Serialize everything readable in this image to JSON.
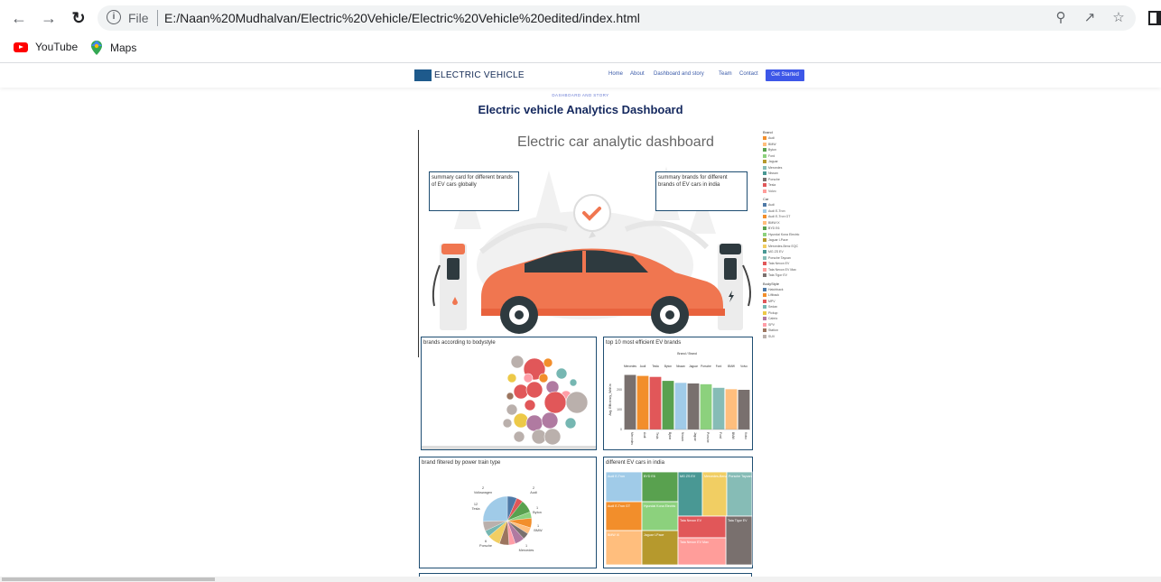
{
  "browser": {
    "scheme_label": "File",
    "url": "E:/Naan%20Mudhalvan/Electric%20Vehicle/Electric%20Vehicle%20edited/index.html",
    "bookmarks": [
      {
        "label": "YouTube",
        "icon": "youtube-icon"
      },
      {
        "label": "Maps",
        "icon": "maps-icon"
      }
    ]
  },
  "site": {
    "logo_text": "ELECTRIC VEHICLE",
    "nav": [
      "Home",
      "About",
      "Dashboard and story",
      "Team",
      "Contact"
    ],
    "cta": "Get Started",
    "eyebrow": "DASHBOARD AND STORY",
    "title": "Electric vehicle Analytics Dashboard"
  },
  "dashboard": {
    "hero_title": "Electric car analytic dashboard",
    "summary_global": "summary card for different brands of EV cars globally",
    "summary_india": "summary brands for different brands of EV cars in india",
    "bubble_title": "brands according to bodystyle",
    "bar_title": "top 10 most efficient EV brands",
    "pie_title": "brand filtered by power train type",
    "treemap_title": "different EV cars in india"
  },
  "legend": {
    "brand_head": "Brand",
    "brands": [
      {
        "label": "Audi",
        "color": "#f28e2b"
      },
      {
        "label": "BMW",
        "color": "#ffbe7d"
      },
      {
        "label": "Byton",
        "color": "#59a14f"
      },
      {
        "label": "Ford",
        "color": "#8cd17d"
      },
      {
        "label": "Jaguar",
        "color": "#b6992d"
      },
      {
        "label": "Mercedes",
        "color": "#86bcb6"
      },
      {
        "label": "Nissan",
        "color": "#499894"
      },
      {
        "label": "Porsche",
        "color": "#79706e"
      },
      {
        "label": "Tesla",
        "color": "#e15759"
      },
      {
        "label": "Volvo",
        "color": "#ff9d9a"
      }
    ],
    "car_head": "Car",
    "cars": [
      {
        "label": "Audi",
        "color": "#4e79a7"
      },
      {
        "label": "Audi E-Tron",
        "color": "#a0cbe8"
      },
      {
        "label": "Audi E-Tron GT",
        "color": "#f28e2b"
      },
      {
        "label": "BMW iX",
        "color": "#ffbe7d"
      },
      {
        "label": "BYD E6",
        "color": "#59a14f"
      },
      {
        "label": "Hyundai Kona Electric",
        "color": "#8cd17d"
      },
      {
        "label": "Jaguar I-Pace",
        "color": "#b6992d"
      },
      {
        "label": "Mercedes-Benz EQC",
        "color": "#f1ce63"
      },
      {
        "label": "MG ZS EV",
        "color": "#499894"
      },
      {
        "label": "Porsche Taycan",
        "color": "#86bcb6"
      },
      {
        "label": "Tata Nexon EV",
        "color": "#e15759"
      },
      {
        "label": "Tata Nexon EV Max",
        "color": "#ff9d9a"
      },
      {
        "label": "Tata Tigor EV",
        "color": "#79706e"
      }
    ],
    "body_head": "BodyStyle",
    "bodies": [
      {
        "label": "Hatchback",
        "color": "#4e79a7"
      },
      {
        "label": "Liftback",
        "color": "#f28e2b"
      },
      {
        "label": "MPV",
        "color": "#e15759"
      },
      {
        "label": "Sedan",
        "color": "#76b7b2"
      },
      {
        "label": "Pickup",
        "color": "#edc948"
      },
      {
        "label": "Cabrio",
        "color": "#b07aa1"
      },
      {
        "label": "SPV",
        "color": "#ff9da7"
      },
      {
        "label": "Station",
        "color": "#9c755f"
      },
      {
        "label": "SUV",
        "color": "#bab0ac"
      }
    ]
  },
  "chart_data": {
    "type": "bar",
    "title": "top 10 most efficient EV brands",
    "header": "Brand / Brand",
    "categories": [
      "Mercedes",
      "Audi",
      "Tesla",
      "Byton",
      "Nissan",
      "Jaguar",
      "Porsche",
      "Ford",
      "BMW",
      "Volvo"
    ],
    "colors": [
      "#79706e",
      "#f28e2b",
      "#e15759",
      "#59a14f",
      "#a0cbe8",
      "#79706e",
      "#8cd17d",
      "#86bcb6",
      "#ffbe7d",
      "#79706e"
    ],
    "values": [
      275,
      270,
      265,
      245,
      235,
      232,
      228,
      210,
      203,
      200
    ],
    "ylabel": "Avg. Efficiency_WhKm",
    "yticks": [
      0,
      100,
      200
    ],
    "ylim": [
      0,
      300
    ]
  },
  "pie": {
    "labels": [
      "Volkswagen",
      "Tesla",
      "Porsche",
      "Mercedes",
      "Audi",
      "Byton",
      "BMW"
    ],
    "values": [
      2,
      12,
      6,
      1,
      2,
      1,
      1
    ]
  },
  "treemap": [
    {
      "label": "Audi E-Tron",
      "color": "#a0cbe8"
    },
    {
      "label": "BYD E6",
      "color": "#59a14f"
    },
    {
      "label": "MG ZS EV",
      "color": "#499894"
    },
    {
      "label": "Mercedes-Benz EQC",
      "color": "#f1ce63"
    },
    {
      "label": "Porsche Taycan",
      "color": "#86bcb6"
    },
    {
      "label": "Audi E-Tron GT",
      "color": "#f28e2b"
    },
    {
      "label": "Hyundai Kona Electric",
      "color": "#8cd17d"
    },
    {
      "label": "Tata Nexon EV",
      "color": "#e15759"
    },
    {
      "label": "Tata Tigor EV",
      "color": "#79706e"
    },
    {
      "label": "BMW iX",
      "color": "#ffbe7d"
    },
    {
      "label": "Jaguar I-Pace",
      "color": "#b6992d"
    },
    {
      "label": "Tata Nexon EV Max",
      "color": "#ff9d9a"
    }
  ]
}
